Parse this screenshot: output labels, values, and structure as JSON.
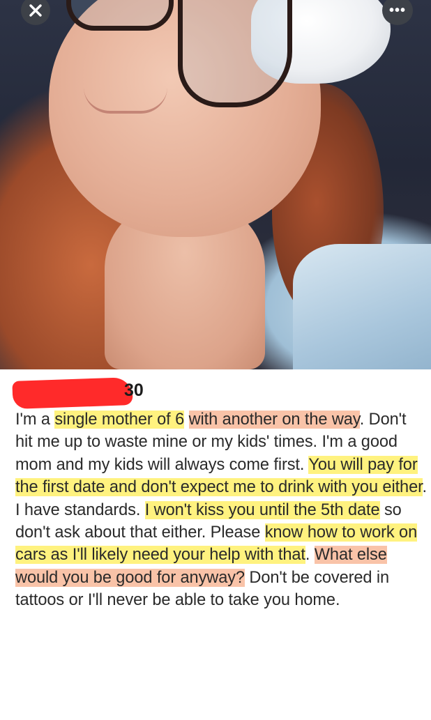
{
  "profile": {
    "age": "30",
    "bio": [
      {
        "text": "I'm a ",
        "hl": ""
      },
      {
        "text": "single mother of 6",
        "hl": "y"
      },
      {
        "text": " ",
        "hl": ""
      },
      {
        "text": "with another on the way",
        "hl": "r"
      },
      {
        "text": ". Don't hit me up to waste mine or my kids' times. I'm a good mom and my kids will always come first. ",
        "hl": ""
      },
      {
        "text": "You will pay for the first date and don't expect me to drink with you either",
        "hl": "y"
      },
      {
        "text": ". I have standards. ",
        "hl": ""
      },
      {
        "text": "I won't kiss you until the 5th date",
        "hl": "y"
      },
      {
        "text": " so don't ask about that either. Please ",
        "hl": ""
      },
      {
        "text": "know how to work on cars as I'll likely need your help with that",
        "hl": "y"
      },
      {
        "text": ". ",
        "hl": ""
      },
      {
        "text": "What else would you be good for anyway?",
        "hl": "r"
      },
      {
        "text": " Don't be covered in tattoos or I'll never be able to take you home.",
        "hl": ""
      }
    ]
  },
  "controls": {
    "close_icon": "close-icon",
    "more_icon": "more-options-icon",
    "more_glyph": "•••"
  },
  "colors": {
    "highlight_yellow": "#fff27f",
    "highlight_red": "#f9c3a8",
    "redaction": "#ff2a2a"
  }
}
